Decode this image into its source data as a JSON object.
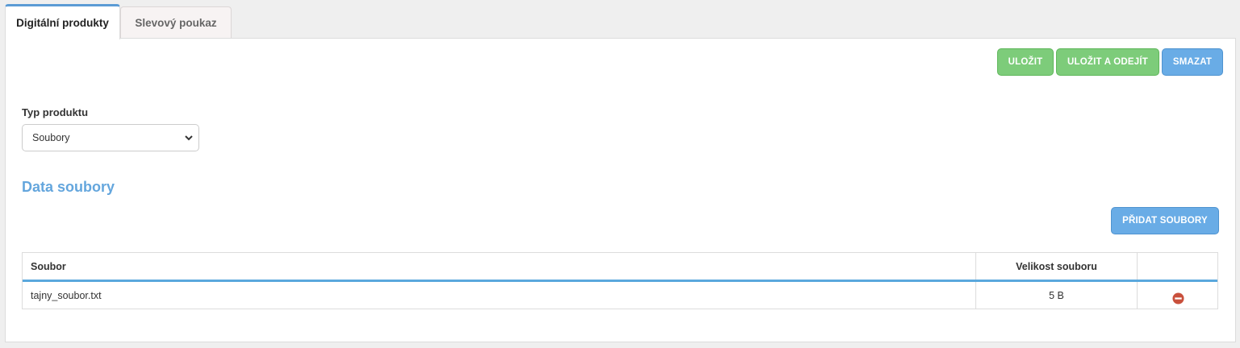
{
  "tabs": [
    {
      "label": "Digitální produkty",
      "active": true
    },
    {
      "label": "Slevový poukaz",
      "active": false
    }
  ],
  "toolbar": {
    "save_label": "ULOŽIT",
    "save_exit_label": "ULOŽIT A ODEJÍT",
    "delete_label": "SMAZAT"
  },
  "product_type": {
    "label": "Typ produktu",
    "selected": "Soubory"
  },
  "files_section": {
    "title": "Data soubory",
    "add_button_label": "PŘIDAT SOUBORY",
    "columns": [
      "Soubor",
      "Velikost souboru",
      ""
    ],
    "rows": [
      {
        "file": "tajny_soubor.txt",
        "size": "5 B",
        "action_icon": "remove-icon"
      }
    ]
  },
  "colors": {
    "green_button": "#7dcc7a",
    "blue_button": "#69ace6",
    "section_title": "#64a6dd",
    "table_accent": "#5aa8dd",
    "remove_icon": "#c9503c"
  }
}
